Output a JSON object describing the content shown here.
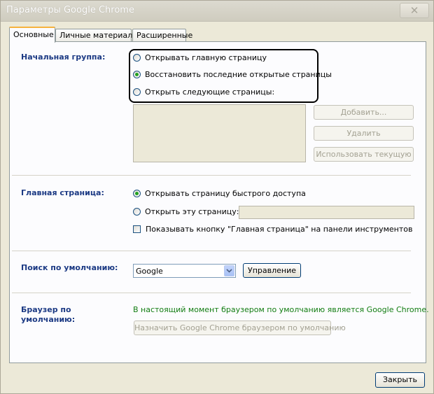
{
  "window": {
    "title": "Параметры Google Chrome",
    "close_glyph": "✕"
  },
  "tabs": [
    {
      "label": "Основные",
      "active": true
    },
    {
      "label": "Личные материалы",
      "active": false
    },
    {
      "label": "Расширенные",
      "active": false
    }
  ],
  "startup": {
    "label": "Начальная группа:",
    "options": [
      {
        "label": "Открывать главную страницу",
        "checked": false
      },
      {
        "label": "Восстановить последние открытые страницы",
        "checked": true
      },
      {
        "label": "Открыть следующие страницы:",
        "checked": false
      }
    ],
    "buttons": {
      "add": "Добавить...",
      "remove": "Удалить",
      "use_current": "Использовать текущую"
    }
  },
  "homepage": {
    "label": "Главная страница:",
    "options": [
      {
        "label": "Открывать страницу быстрого доступа",
        "checked": true
      },
      {
        "label": "Открыть эту страницу:",
        "checked": false
      }
    ],
    "url_value": "",
    "show_button_label": "Показывать кнопку \"Главная страница\" на панели инструментов",
    "show_button_checked": false
  },
  "search": {
    "label": "Поиск по умолчанию:",
    "selected": "Google",
    "manage_label": "Управление"
  },
  "default_browser": {
    "label_line1": "Браузер по",
    "label_line2": "умолчанию:",
    "status": "В настоящий момент браузером по умолчанию является Google Chrome.",
    "make_default_label": "Назначить Google Chrome браузером по умолчанию",
    "status_color": "#127d12"
  },
  "footer": {
    "close_label": "Закрыть"
  }
}
